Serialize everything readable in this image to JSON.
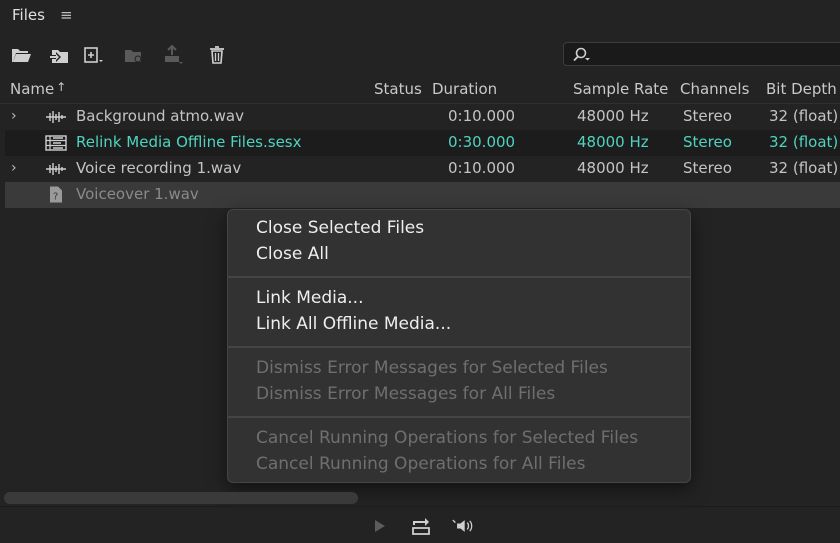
{
  "panel": {
    "title": "Files",
    "menu_icon": "hamburger-menu-icon"
  },
  "toolbar": {
    "icons": [
      "open-folder-icon",
      "import-icon",
      "new-file-icon",
      "insert-folder-icon",
      "export-icon",
      "trash-icon"
    ],
    "search": {
      "value": "",
      "icon": "search-icon"
    }
  },
  "columns": {
    "name": "Name",
    "sort_arrow": "↑",
    "status": "Status",
    "duration": "Duration",
    "sample_rate": "Sample Rate",
    "channels": "Channels",
    "bit_depth": "Bit Depth"
  },
  "files": [
    {
      "name": "Background atmo.wav",
      "status": "",
      "duration": "0:10.000",
      "sample_rate": "48000 Hz",
      "channels": "Stereo",
      "bit_depth": "32 (float)",
      "icon": "waveform-icon",
      "expandable": "›"
    },
    {
      "name": "Relink Media Offline Files.sesx",
      "status": "",
      "duration": "0:30.000",
      "sample_rate": "48000 Hz",
      "channels": "Stereo",
      "bit_depth": "32 (float)",
      "icon": "multitrack-session-icon",
      "expandable": ""
    },
    {
      "name": "Voice recording 1.wav",
      "status": "",
      "duration": "0:10.000",
      "sample_rate": "48000 Hz",
      "channels": "Stereo",
      "bit_depth": "32 (float)",
      "icon": "waveform-icon",
      "expandable": "›"
    },
    {
      "name": "Voiceover 1.wav",
      "status": "",
      "duration": "",
      "sample_rate": "",
      "channels": "",
      "bit_depth": "",
      "icon": "offline-file-icon",
      "expandable": ""
    }
  ],
  "context_menu": {
    "groups": [
      [
        {
          "label": "Close Selected Files",
          "enabled": true
        },
        {
          "label": "Close All",
          "enabled": true
        }
      ],
      [
        {
          "label": "Link Media...",
          "enabled": true
        },
        {
          "label": "Link All Offline Media...",
          "enabled": true
        }
      ],
      [
        {
          "label": "Dismiss Error Messages for Selected Files",
          "enabled": false
        },
        {
          "label": "Dismiss Error Messages for All Files",
          "enabled": false
        }
      ],
      [
        {
          "label": "Cancel Running Operations for Selected Files",
          "enabled": false
        },
        {
          "label": "Cancel Running Operations for All Files",
          "enabled": false
        }
      ]
    ]
  },
  "transport": {
    "icons": [
      "play-icon",
      "loop-icon",
      "autoplay-speaker-icon"
    ]
  },
  "colors": {
    "linked_text": "#4fd3c0",
    "background": "#232323",
    "menu_bg": "#323232"
  }
}
